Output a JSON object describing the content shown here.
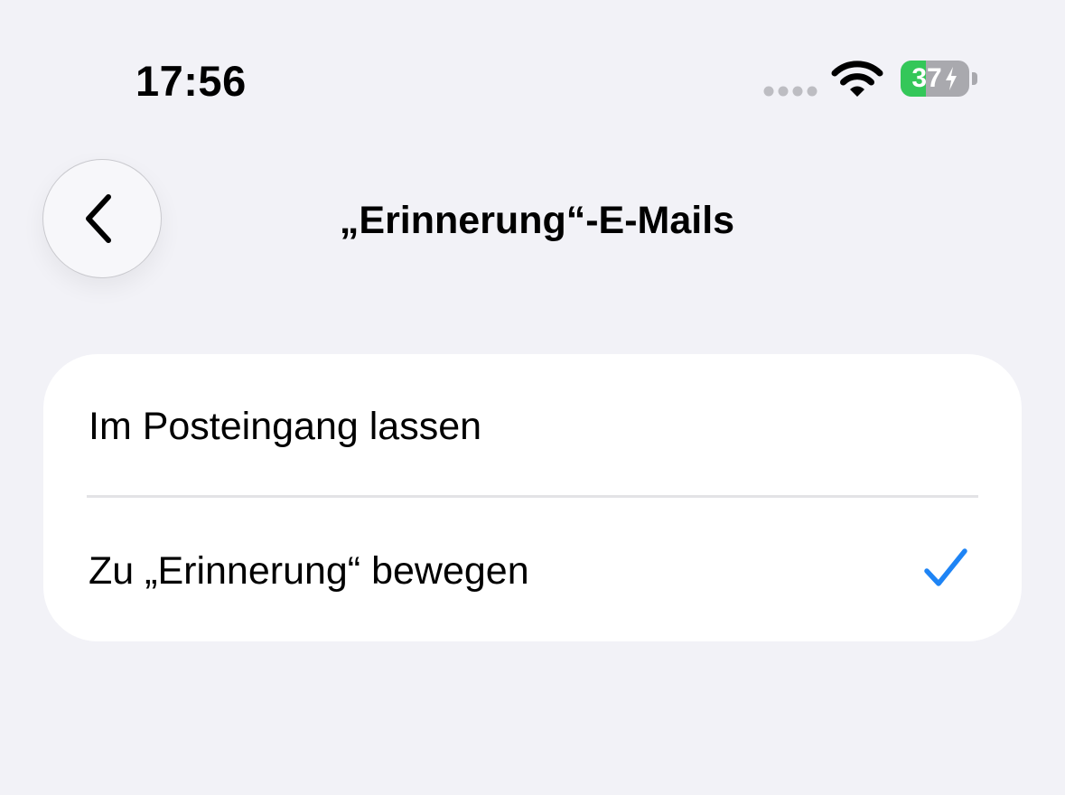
{
  "status_bar": {
    "time": "17:56",
    "battery_level": "37",
    "battery_fraction": 0.37,
    "charging": true,
    "icons": [
      "signal-dots-icon",
      "wifi-icon",
      "battery-icon",
      "charging-bolt-icon"
    ]
  },
  "nav": {
    "back_icon": "chevron-left-icon",
    "title": "„Erinnerung“-E-Mails"
  },
  "options": [
    {
      "label": "Im Posteingang lassen",
      "selected": false
    },
    {
      "label": "Zu „Erinnerung“ bewegen",
      "selected": true
    }
  ],
  "colors": {
    "background": "#f2f2f7",
    "card": "#ffffff",
    "accent": "#1e84f5",
    "battery_fill": "#34c759",
    "battery_empty": "#a9a9ae"
  }
}
